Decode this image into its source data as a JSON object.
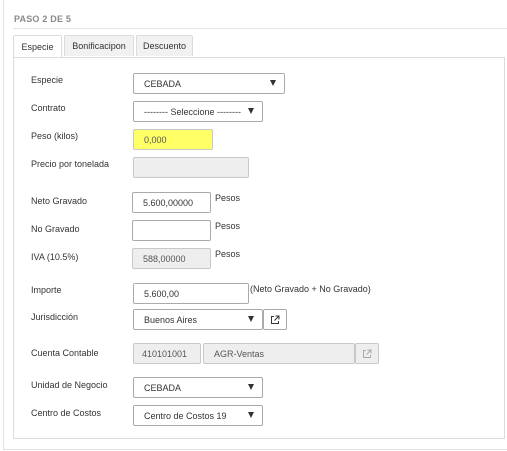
{
  "step_title": "PASO 2 DE 5",
  "tabs": [
    {
      "label": "Especie",
      "active": true
    },
    {
      "label": "Bonificacipon",
      "active": false
    },
    {
      "label": "Descuento",
      "active": false
    }
  ],
  "form": {
    "especie": {
      "label": "Especie",
      "value": "CEBADA"
    },
    "contrato": {
      "label": "Contrato",
      "value": "-------- Seleccione --------"
    },
    "peso": {
      "label": "Peso (kilos)",
      "value": "0,000"
    },
    "precio": {
      "label": "Precio por tonelada",
      "value": ""
    },
    "neto_gravado": {
      "label": "Neto Gravado",
      "value": "5.600,00000",
      "suffix": "Pesos"
    },
    "no_gravado": {
      "label": "No Gravado",
      "value": "",
      "suffix": "Pesos"
    },
    "iva": {
      "label": "IVA (10.5%)",
      "value": "588,00000",
      "suffix": "Pesos"
    },
    "importe": {
      "label": "Importe",
      "value": "5.600,00",
      "suffix": "(Neto Gravado + No Gravado)"
    },
    "jurisdiccion": {
      "label": "Jurisdicción",
      "value": "Buenos Aires"
    },
    "cuenta_contable": {
      "label": "Cuenta Contable",
      "code": "410101001",
      "name": "AGR-Ventas"
    },
    "unidad_negocio": {
      "label": "Unidad de Negocio",
      "value": "CEBADA"
    },
    "centro_costos": {
      "label": "Centro de Costos",
      "value": "Centro de Costos 19"
    }
  },
  "colors": {
    "accent_green": "#3bb54a",
    "highlight_yellow": "#ffff66",
    "disabled_gray": "#eeeeee"
  },
  "icons": {
    "external_link": "external-link-icon",
    "caret": "chevron-down-icon"
  }
}
